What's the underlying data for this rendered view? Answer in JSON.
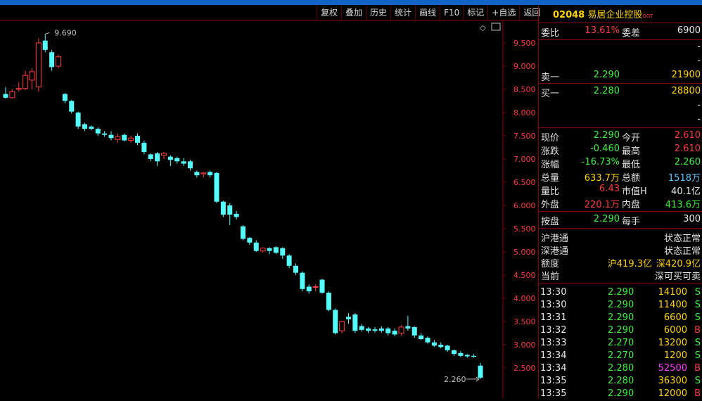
{
  "toolbar": [
    "复权",
    "叠加",
    "历史",
    "统计",
    "画线",
    "F10",
    "标记",
    "+自选",
    "返回"
  ],
  "title": {
    "code": "02048",
    "name": "易居企业控股",
    "tag": "GGT"
  },
  "weibi": {
    "label": "委比",
    "value": "13.61%",
    "label2": "委差",
    "value2": "6900"
  },
  "orderbook": {
    "sell_filler": [
      "-",
      "-"
    ],
    "sell1": {
      "label": "卖一",
      "price": "2.290",
      "vol": "21900"
    },
    "buy1": {
      "label": "买一",
      "price": "2.280",
      "vol": "28800"
    },
    "buy_filler": [
      "-",
      "-"
    ]
  },
  "quote": [
    {
      "l1": "现价",
      "v1": "2.290",
      "l2": "今开",
      "v2": "2.610",
      "c1": "green",
      "c2": "red"
    },
    {
      "l1": "涨跌",
      "v1": "-0.460",
      "l2": "最高",
      "v2": "2.610",
      "c1": "green",
      "c2": "red"
    },
    {
      "l1": "涨幅",
      "v1": "-16.73%",
      "l2": "最低",
      "v2": "2.260",
      "c1": "green",
      "c2": "green"
    },
    {
      "l1": "总量",
      "v1": "633.7万",
      "l2": "总额",
      "v2": "1518万",
      "c1": "yellow",
      "c2": "cyan"
    },
    {
      "l1": "量比",
      "v1": "6.43",
      "l2": "市值H",
      "v2": "40.1亿",
      "c1": "red",
      "c2": "white"
    },
    {
      "l1": "外盘",
      "v1": "220.1万",
      "l2": "内盘",
      "v2": "413.6万",
      "c1": "red",
      "c2": "green"
    }
  ],
  "lot": {
    "l1": "按盘",
    "v1": "2.290",
    "l2": "每手",
    "v2": "300"
  },
  "connect": {
    "sh_label": "沪港通",
    "sh_status": "状态正常",
    "sz_label": "深港通",
    "sz_status": "状态正常",
    "quota_label": "额度",
    "quota_sh": "沪419.3亿",
    "quota_sz": "深420.9亿",
    "cur_label": "当前",
    "cur_value": "深可买可卖"
  },
  "ticks": [
    {
      "time": "13:30",
      "price": "2.290",
      "vol": "14100",
      "side": "S"
    },
    {
      "time": "13:30",
      "price": "2.290",
      "vol": "11400",
      "side": "S"
    },
    {
      "time": "13:31",
      "price": "2.290",
      "vol": "6600",
      "side": "S"
    },
    {
      "time": "13:32",
      "price": "2.290",
      "vol": "6000",
      "side": "B"
    },
    {
      "time": "13:33",
      "price": "2.270",
      "vol": "13200",
      "side": "S"
    },
    {
      "time": "13:34",
      "price": "2.270",
      "vol": "1200",
      "side": "S"
    },
    {
      "time": "13:34",
      "price": "2.280",
      "vol": "52500",
      "side": "B"
    },
    {
      "time": "13:35",
      "price": "2.280",
      "vol": "36300",
      "side": "S"
    },
    {
      "time": "13:35",
      "price": "2.290",
      "vol": "12000",
      "side": "B"
    }
  ],
  "chart_data": {
    "type": "candlestick",
    "y_ticks": [
      "9.500",
      "9.000",
      "8.500",
      "8.000",
      "7.500",
      "7.000",
      "6.500",
      "6.000",
      "5.500",
      "5.000",
      "4.500",
      "4.000",
      "3.500",
      "3.000",
      "2.500"
    ],
    "ylim": [
      2.25,
      9.8
    ],
    "high_marker": "9.690",
    "low_marker": "2.260",
    "candles": [
      {
        "o": 8.4,
        "c": 8.32,
        "h": 8.55,
        "l": 8.3
      },
      {
        "o": 8.32,
        "c": 8.45,
        "h": 8.5,
        "l": 8.3
      },
      {
        "o": 8.5,
        "c": 8.52,
        "h": 8.65,
        "l": 8.45
      },
      {
        "o": 8.52,
        "c": 8.8,
        "h": 8.9,
        "l": 8.48
      },
      {
        "o": 8.7,
        "c": 8.88,
        "h": 8.95,
        "l": 8.5
      },
      {
        "o": 8.55,
        "c": 9.5,
        "h": 9.6,
        "l": 8.45
      },
      {
        "o": 9.55,
        "c": 9.35,
        "h": 9.69,
        "l": 9.3
      },
      {
        "o": 9.3,
        "c": 8.98,
        "h": 9.35,
        "l": 8.9
      },
      {
        "o": 9.0,
        "c": 9.2,
        "h": 9.25,
        "l": 8.95
      },
      {
        "o": 8.4,
        "c": 8.25,
        "h": 8.42,
        "l": 8.2
      },
      {
        "o": 8.25,
        "c": 8.02,
        "h": 8.27,
        "l": 7.98
      },
      {
        "o": 8.0,
        "c": 7.7,
        "h": 8.02,
        "l": 7.65
      },
      {
        "o": 7.75,
        "c": 7.65,
        "h": 7.78,
        "l": 7.6
      },
      {
        "o": 7.7,
        "c": 7.65,
        "h": 7.72,
        "l": 7.62
      },
      {
        "o": 7.65,
        "c": 7.55,
        "h": 7.68,
        "l": 7.5
      },
      {
        "o": 7.55,
        "c": 7.52,
        "h": 7.6,
        "l": 7.48
      },
      {
        "o": 7.52,
        "c": 7.45,
        "h": 7.6,
        "l": 7.4
      },
      {
        "o": 7.42,
        "c": 7.48,
        "h": 7.55,
        "l": 7.35
      },
      {
        "o": 7.52,
        "c": 7.4,
        "h": 7.55,
        "l": 7.38
      },
      {
        "o": 7.4,
        "c": 7.45,
        "h": 7.5,
        "l": 7.35
      },
      {
        "o": 7.5,
        "c": 7.35,
        "h": 7.55,
        "l": 7.3
      },
      {
        "o": 7.35,
        "c": 7.15,
        "h": 7.4,
        "l": 7.1
      },
      {
        "o": 7.1,
        "c": 7.0,
        "h": 7.12,
        "l": 6.95
      },
      {
        "o": 7.12,
        "c": 6.95,
        "h": 7.15,
        "l": 6.85
      },
      {
        "o": 7.08,
        "c": 7.12,
        "h": 7.15,
        "l": 7.0
      },
      {
        "o": 7.05,
        "c": 6.98,
        "h": 7.08,
        "l": 6.85
      },
      {
        "o": 7.02,
        "c": 6.95,
        "h": 7.05,
        "l": 6.9
      },
      {
        "o": 6.95,
        "c": 6.9,
        "h": 7.02,
        "l": 6.85
      },
      {
        "o": 6.95,
        "c": 6.8,
        "h": 6.98,
        "l": 6.75
      },
      {
        "o": 6.72,
        "c": 6.65,
        "h": 6.75,
        "l": 6.6
      },
      {
        "o": 6.68,
        "c": 6.7,
        "h": 6.72,
        "l": 6.6
      },
      {
        "o": 6.72,
        "c": 6.65,
        "h": 6.75,
        "l": 6.6
      },
      {
        "o": 6.7,
        "c": 6.08,
        "h": 6.72,
        "l": 6.05
      },
      {
        "o": 6.08,
        "c": 5.8,
        "h": 6.1,
        "l": 5.75
      },
      {
        "o": 6.0,
        "c": 5.8,
        "h": 6.05,
        "l": 5.58
      },
      {
        "o": 5.82,
        "c": 5.75,
        "h": 5.88,
        "l": 5.7
      },
      {
        "o": 5.55,
        "c": 5.28,
        "h": 5.58,
        "l": 5.25
      },
      {
        "o": 5.3,
        "c": 5.2,
        "h": 5.32,
        "l": 5.15
      },
      {
        "o": 5.2,
        "c": 5.02,
        "h": 5.25,
        "l": 5.0
      },
      {
        "o": 5.02,
        "c": 5.08,
        "h": 5.1,
        "l": 4.98
      },
      {
        "o": 5.08,
        "c": 5.02,
        "h": 5.1,
        "l": 4.95
      },
      {
        "o": 5.1,
        "c": 4.98,
        "h": 5.12,
        "l": 4.95
      },
      {
        "o": 5.08,
        "c": 4.92,
        "h": 5.1,
        "l": 4.85
      },
      {
        "o": 4.92,
        "c": 4.7,
        "h": 4.95,
        "l": 4.65
      },
      {
        "o": 4.7,
        "c": 4.55,
        "h": 4.75,
        "l": 4.5
      },
      {
        "o": 4.55,
        "c": 4.2,
        "h": 4.58,
        "l": 4.15
      },
      {
        "o": 4.25,
        "c": 4.15,
        "h": 4.3,
        "l": 4.1
      },
      {
        "o": 4.25,
        "c": 4.25,
        "h": 4.3,
        "l": 4.15
      },
      {
        "o": 4.4,
        "c": 4.12,
        "h": 4.42,
        "l": 4.1
      },
      {
        "o": 4.12,
        "c": 3.75,
        "h": 4.15,
        "l": 3.72
      },
      {
        "o": 3.75,
        "c": 3.25,
        "h": 3.78,
        "l": 3.22
      },
      {
        "o": 3.3,
        "c": 3.5,
        "h": 3.52,
        "l": 3.25
      },
      {
        "o": 3.6,
        "c": 3.55,
        "h": 3.68,
        "l": 3.45
      },
      {
        "o": 3.65,
        "c": 3.3,
        "h": 3.68,
        "l": 3.25
      },
      {
        "o": 3.4,
        "c": 3.32,
        "h": 3.45,
        "l": 3.28
      },
      {
        "o": 3.35,
        "c": 3.3,
        "h": 3.38,
        "l": 3.25
      },
      {
        "o": 3.33,
        "c": 3.3,
        "h": 3.38,
        "l": 3.26
      },
      {
        "o": 3.35,
        "c": 3.3,
        "h": 3.4,
        "l": 3.26
      },
      {
        "o": 3.35,
        "c": 3.25,
        "h": 3.38,
        "l": 3.2
      },
      {
        "o": 3.3,
        "c": 3.22,
        "h": 3.35,
        "l": 3.18
      },
      {
        "o": 3.25,
        "c": 3.38,
        "h": 3.42,
        "l": 3.2
      },
      {
        "o": 3.4,
        "c": 3.35,
        "h": 3.62,
        "l": 3.3
      },
      {
        "o": 3.38,
        "c": 3.2,
        "h": 3.4,
        "l": 3.15
      },
      {
        "o": 3.2,
        "c": 3.12,
        "h": 3.25,
        "l": 3.1
      },
      {
        "o": 3.15,
        "c": 3.05,
        "h": 3.18,
        "l": 3.02
      },
      {
        "o": 3.05,
        "c": 2.98,
        "h": 3.1,
        "l": 2.95
      },
      {
        "o": 3.0,
        "c": 2.95,
        "h": 3.05,
        "l": 2.92
      },
      {
        "o": 2.98,
        "c": 2.88,
        "h": 3.0,
        "l": 2.85
      },
      {
        "o": 2.88,
        "c": 2.8,
        "h": 2.9,
        "l": 2.76
      },
      {
        "o": 2.82,
        "c": 2.76,
        "h": 2.86,
        "l": 2.73
      },
      {
        "o": 2.78,
        "c": 2.75,
        "h": 2.8,
        "l": 2.72
      },
      {
        "o": 2.76,
        "c": 2.74,
        "h": 2.8,
        "l": 2.72
      },
      {
        "o": 2.55,
        "c": 2.29,
        "h": 2.61,
        "l": 2.26
      }
    ]
  }
}
